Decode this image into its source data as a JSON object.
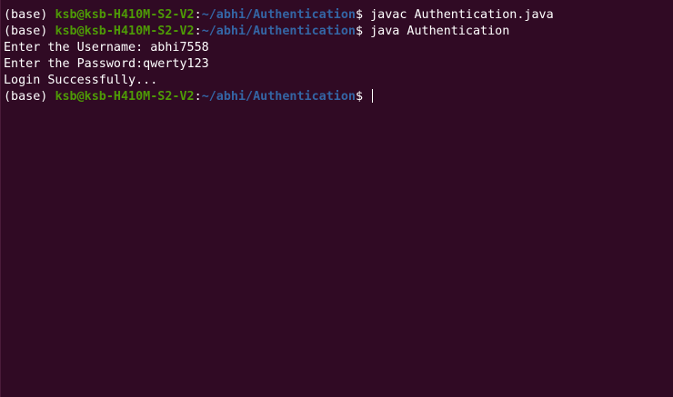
{
  "terminal": {
    "lines": [
      {
        "prefix": "(base) ",
        "user_host": "ksb@ksb-H410M-S2-V2",
        "colon": ":",
        "path": "~/abhi/Authentication",
        "suffix": "$ ",
        "command": "javac Authentication.java"
      },
      {
        "prefix": "(base) ",
        "user_host": "ksb@ksb-H410M-S2-V2",
        "colon": ":",
        "path": "~/abhi/Authentication",
        "suffix": "$ ",
        "command": "java Authentication"
      },
      {
        "output": "Enter the Username: abhi7558"
      },
      {
        "output": "Enter the Password:qwerty123"
      },
      {
        "output": "Login Successfully..."
      },
      {
        "prefix": "(base) ",
        "user_host": "ksb@ksb-H410M-S2-V2",
        "colon": ":",
        "path": "~/abhi/Authentication",
        "suffix": "$ ",
        "command": ""
      }
    ]
  },
  "colors": {
    "background": "#300a24",
    "user_host": "#4e9a06",
    "path": "#3465a4",
    "text": "#ffffff"
  }
}
